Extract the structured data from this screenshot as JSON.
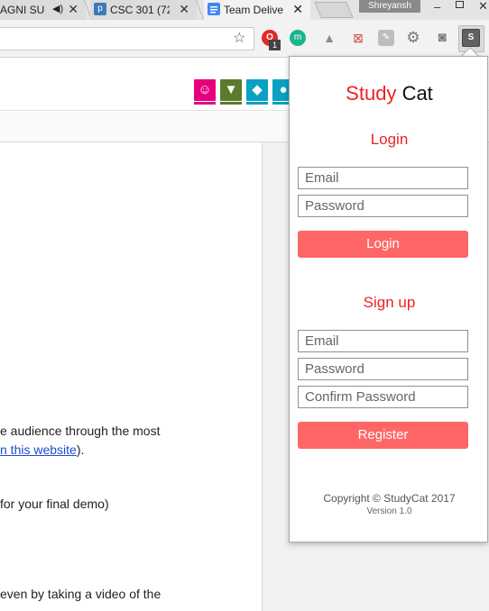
{
  "browser": {
    "tabs": [
      {
        "title": "AGNI SU",
        "favicon": "speaker-icon"
      },
      {
        "title": "CSC 301 (72",
        "favicon": "piazza-icon"
      },
      {
        "title": "Team Delive",
        "favicon": "docs-icon"
      }
    ],
    "profile_name": "Shreyansh",
    "close_glyph": "✕",
    "window_controls": {
      "minimize": "–",
      "close": "✕"
    },
    "extensions": {
      "opera_label": "O",
      "opera_badge": "1",
      "m_label": "m",
      "studycat_label": "S"
    },
    "colors": {
      "tab_active": "#f2f2f2",
      "docs_blue": "#4285f4"
    }
  },
  "page": {
    "lines": [
      {
        "text": "e audience through the most"
      },
      {
        "text_pre": "",
        "link": "n this website",
        "text_post": ")."
      },
      {
        "text": "for your final demo)"
      },
      {
        "text": "even by taking a video of the"
      }
    ],
    "brand_tiles": [
      {
        "color": "#e6007e",
        "bar": "#e6007e",
        "glyph": "☺",
        "icon": "pig-icon"
      },
      {
        "color": "#5c7a2b",
        "bar": "#5c7a2b",
        "glyph": "▼",
        "icon": "badger-icon"
      },
      {
        "color": "#0aa1c2",
        "bar": "#0aa1c2",
        "glyph": "◆",
        "icon": "duck-icon"
      },
      {
        "color": "#0aa1c2",
        "bar": "#0aa1c2",
        "glyph": "●",
        "icon": "panda-icon"
      }
    ]
  },
  "popup": {
    "logo_study": "Study",
    "logo_cat": "Cat",
    "login": {
      "heading": "Login",
      "email_placeholder": "Email",
      "password_placeholder": "Password",
      "button": "Login"
    },
    "signup": {
      "heading": "Sign up",
      "email_placeholder": "Email",
      "password_placeholder": "Password",
      "confirm_placeholder": "Confirm Password",
      "button": "Register"
    },
    "copyright": "Copyright © StudyCat 2017",
    "version": "Version 1.0",
    "colors": {
      "accent": "#ee2222",
      "button": "#ff6666"
    }
  }
}
